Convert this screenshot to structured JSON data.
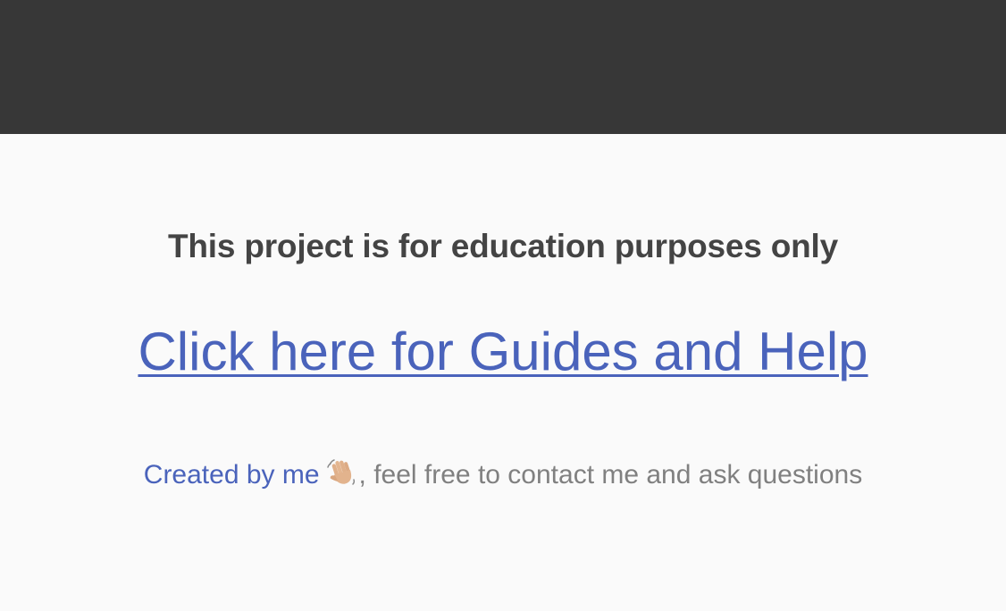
{
  "main": {
    "notice": "This project is for education purposes only",
    "guides_link": "Click here for Guides and Help",
    "footer": {
      "creator_link": "Created by me",
      "wave_icon": "waving-hand-icon",
      "rest_text": ", feel free to contact me and ask questions"
    }
  },
  "colors": {
    "topbar": "#373737",
    "background": "#fafafa",
    "link": "#4a63bb",
    "heading": "#444444",
    "muted_text": "#808080"
  }
}
